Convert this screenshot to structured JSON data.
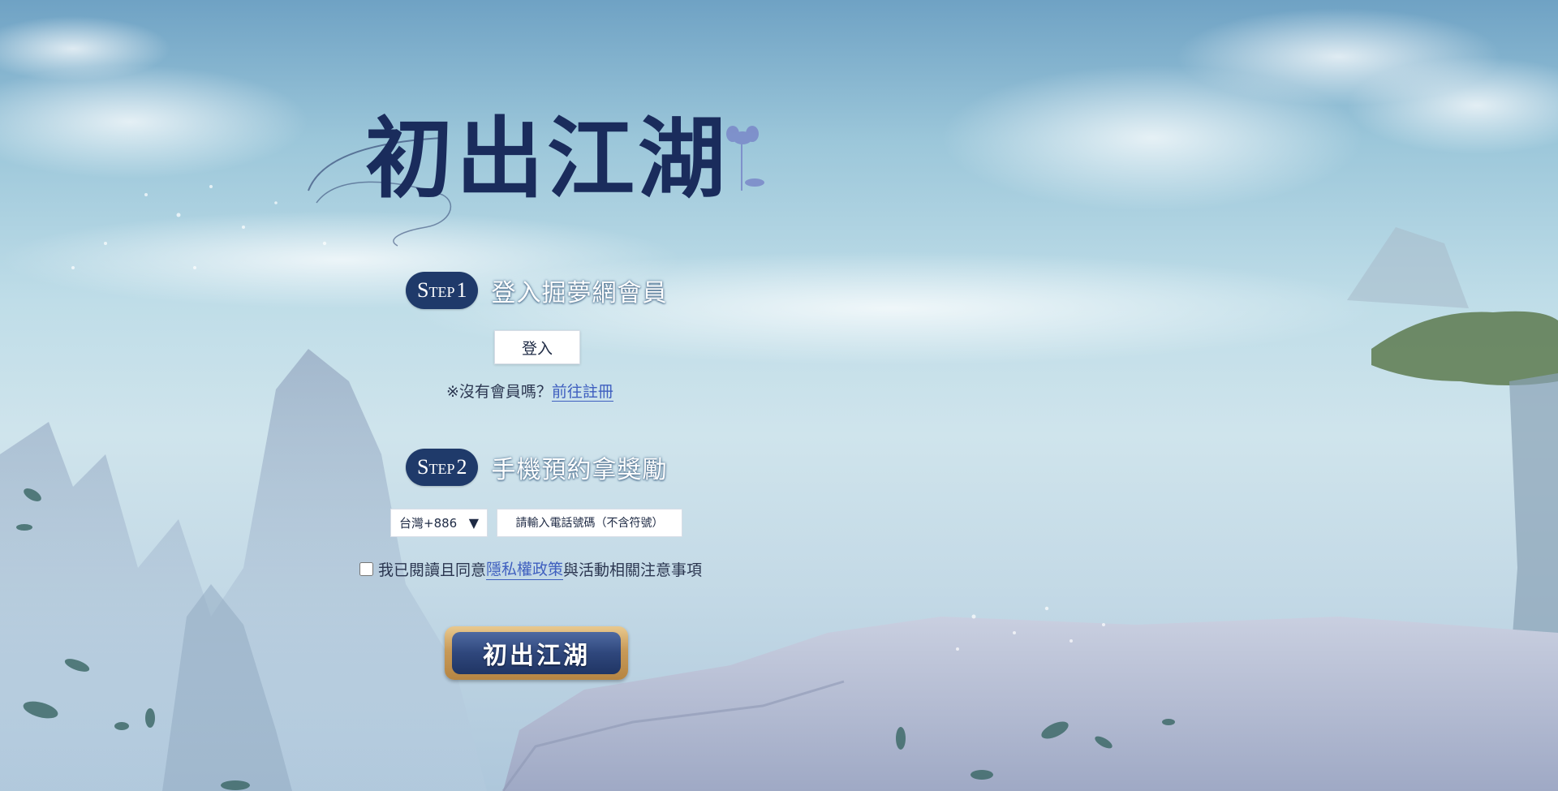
{
  "logo": {
    "title": "初出江湖"
  },
  "step1": {
    "badge_word": "Step",
    "badge_num": "1",
    "title": "登入掘夢網會員"
  },
  "login": {
    "button_label": "登入"
  },
  "register": {
    "prompt": "※沒有會員嗎？",
    "link_label": "前往註冊"
  },
  "step2": {
    "badge_word": "Step",
    "badge_num": "2",
    "title": "手機預約拿獎勵"
  },
  "phone": {
    "country_selected": "台灣+886",
    "input_placeholder": "請輸入電話號碼（不含符號）"
  },
  "agreement": {
    "prefix": "我已閱讀且同意",
    "link_label": "隱私權政策",
    "suffix": "與活動相關注意事項",
    "checked": false
  },
  "submit": {
    "button_label": "初出江湖"
  },
  "colors": {
    "step_pill": "#1f3a6a",
    "link": "#3f5fbf",
    "button_gold": "#c89a58",
    "button_blue": "#2f477c"
  }
}
